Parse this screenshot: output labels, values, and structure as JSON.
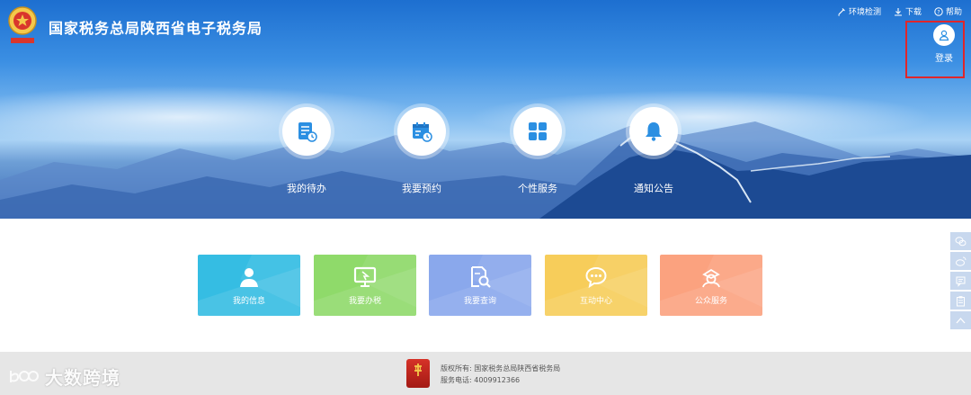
{
  "header": {
    "title": "国家税务总局陕西省电子税务局",
    "links": [
      {
        "label": "环境检测",
        "icon": "tools-icon"
      },
      {
        "label": "下载",
        "icon": "download-icon"
      },
      {
        "label": "帮助",
        "icon": "help-icon"
      }
    ],
    "login_label": "登录"
  },
  "quick_actions": [
    {
      "label": "我的待办",
      "icon": "todo-list-icon"
    },
    {
      "label": "我要预约",
      "icon": "calendar-clock-icon"
    },
    {
      "label": "个性服务",
      "icon": "grid-icon"
    },
    {
      "label": "通知公告",
      "icon": "bell-icon"
    }
  ],
  "service_tiles": [
    {
      "label": "我的信息",
      "icon": "user-icon",
      "color": "#35bde3"
    },
    {
      "label": "我要办税",
      "icon": "monitor-icon",
      "color": "#8fda6a"
    },
    {
      "label": "我要查询",
      "icon": "search-document-icon",
      "color": "#8aa8ec"
    },
    {
      "label": "互动中心",
      "icon": "chat-icon",
      "color": "#f7cd5a"
    },
    {
      "label": "公众服务",
      "icon": "person-service-icon",
      "color": "#fba27f"
    }
  ],
  "side_toolbar": [
    "wechat-icon",
    "weibo-icon",
    "message-icon",
    "clipboard-icon",
    "back-to-top-icon"
  ],
  "footer": {
    "copyright": "版权所有: 国家税务总局陕西省税务局",
    "phone": "服务电话: 4009912366"
  },
  "watermark": "大数跨境",
  "colors": {
    "accent": "#2b8fe2",
    "login_highlight": "#e0262b",
    "footer_bg": "#e6e6e6"
  }
}
